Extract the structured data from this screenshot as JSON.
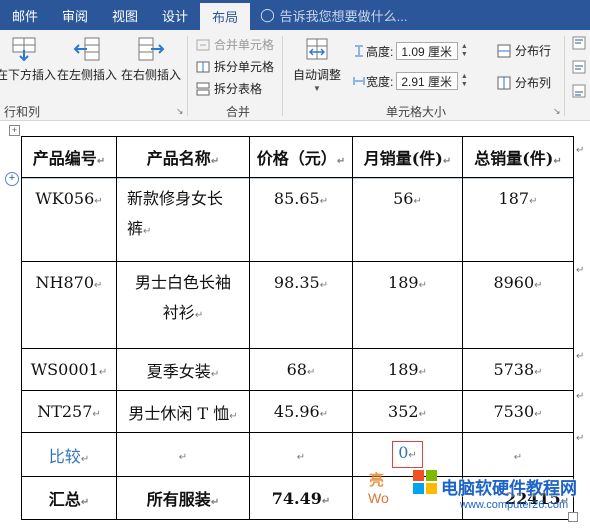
{
  "ribbon": {
    "tabs": [
      "邮件",
      "审阅",
      "视图",
      "设计",
      "布局"
    ],
    "active_tab": "布局",
    "tell_me": "告诉我您想要做什么...",
    "rows_cols": {
      "insert_below": "在下方插入",
      "insert_left": "在左侧插入",
      "insert_right": "在右侧插入",
      "group_label": "行和列"
    },
    "merge": {
      "merge_cells": "合并单元格",
      "split_cells": "拆分单元格",
      "split_table": "拆分表格",
      "group_label": "合并"
    },
    "cell_size": {
      "autofit": "自动调整",
      "height_label": "高度:",
      "height_value": "1.09 厘米",
      "width_label": "宽度:",
      "width_value": "2.91 厘米",
      "distribute_rows": "分布行",
      "distribute_cols": "分布列",
      "group_label": "单元格大小"
    }
  },
  "table": {
    "headers": [
      "产品编号",
      "产品名称",
      "价格（元）",
      "月销量(件)",
      "总销量(件)"
    ],
    "rows": [
      {
        "id": "WK056",
        "name_line1": "新款修身女长",
        "name_line2": "裤",
        "price": "85.65",
        "monthly": "56",
        "total": "187"
      },
      {
        "id": "NH870",
        "name_line1": "男士白色长袖",
        "name_line2": "衬衫",
        "price": "98.35",
        "monthly": "189",
        "total": "8960"
      },
      {
        "id": "WS0001",
        "name_line1": "夏季女装",
        "name_line2": "",
        "price": "68",
        "monthly": "189",
        "total": "5738"
      },
      {
        "id": "NT257",
        "name_line1": "男士休闲 T 恤",
        "name_line2": "",
        "price": "45.96",
        "monthly": "352",
        "total": "7530"
      }
    ],
    "compare_row": {
      "label": "比较",
      "monthly": "0"
    },
    "total_row": {
      "label": "汇总",
      "name": "所有服装",
      "price": "74.49",
      "monthly": "",
      "total": "22415"
    }
  },
  "colors": {
    "ribbon_blue": "#2b579a",
    "compare_text": "#2e75b6",
    "highlight_border": "#e0443e"
  },
  "watermark": {
    "line1": "亮",
    "line2": "Wo",
    "site_cn": "电脑软硬件教程网",
    "site_url": "www.computer26.com"
  }
}
